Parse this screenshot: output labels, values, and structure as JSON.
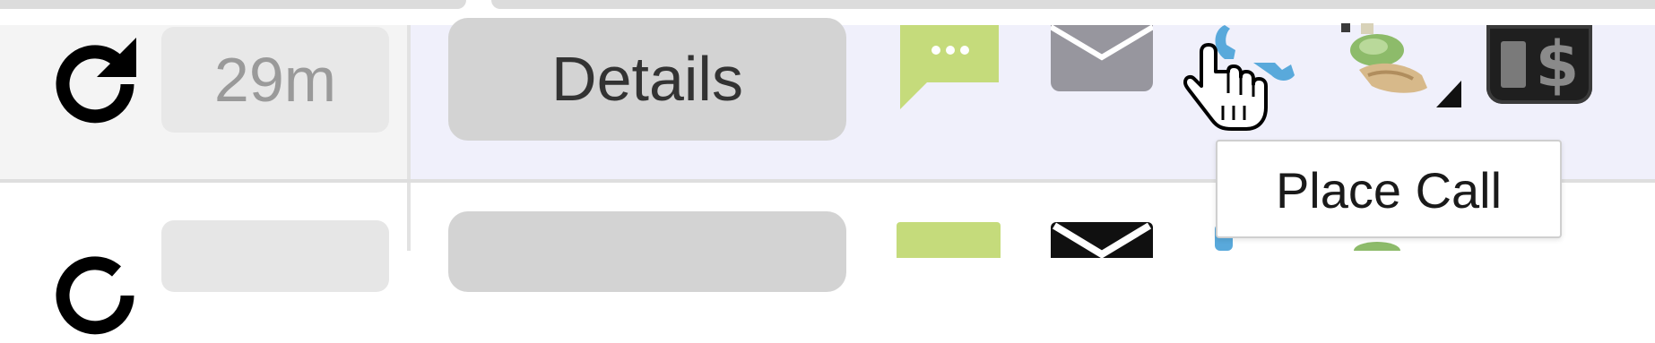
{
  "row": {
    "age": "29m",
    "details_label": "Details"
  },
  "actions": {
    "refresh_icon": "refresh-icon",
    "chat_icon": "chat-icon",
    "email_icon": "email-icon",
    "call_icon": "phone-icon",
    "money_icon": "money-hand-icon",
    "billing_icon": "billing-icon"
  },
  "tooltip": {
    "text": "Place Call"
  },
  "colors": {
    "chat": "#c5db7b",
    "email_row1": "#97969e",
    "email_row2": "#101010",
    "phone": "#59a9db",
    "row_highlight": "#f0f0fb",
    "badge": "#e8e8e8",
    "button": "#d3d3d3"
  }
}
